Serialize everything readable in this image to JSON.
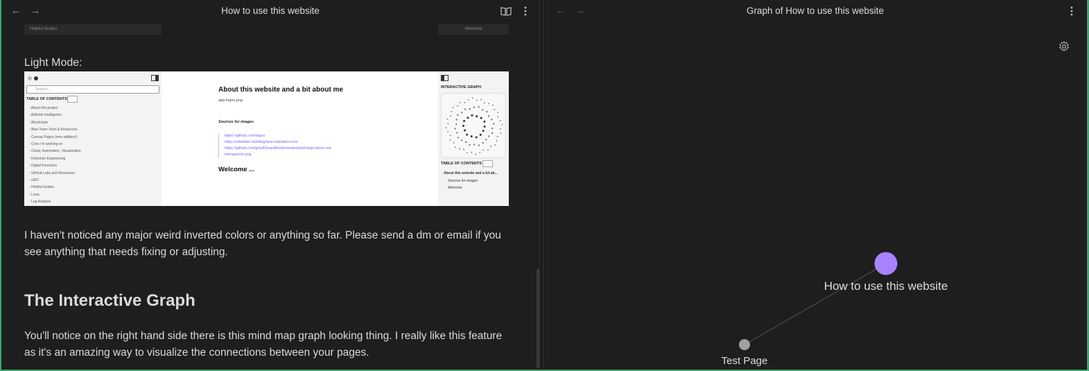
{
  "left_pane": {
    "title": "How to use this website",
    "nav_back_icon": "arrow-left-icon",
    "nav_forward_icon": "arrow-right-icon",
    "reading_view_icon": "book-open-icon",
    "more_icon": "more-vertical-icon",
    "top_strip_left": "Helpful Guides",
    "top_strip_right": "Welcome",
    "light_mode_label": "Light Mode:",
    "screenshot": {
      "search_placeholder": "Search...",
      "toc_heading": "TABLE OF CONTENTS",
      "toc_items": [
        "About this project",
        "Artificial Intelligence",
        "Blockchain",
        "Blue Team Tools & Resources",
        "Canvas Pages (new addition!)",
        "Cons I'm working on",
        "Cloud, Automation, Visualization",
        "Detection Engineering",
        "Digital Forensics",
        "GitHub Labs and Resources",
        "GRC",
        "Helpful Guides",
        "Linux",
        "Log Analysis"
      ],
      "page_title": "About this website and a bit about me",
      "image_alt": "app-logos.png",
      "sources_heading": "Sources for images",
      "links": [
        "https://github.com/logos",
        "https://obsidian.md/blog/new-obsidian-icon/",
        "https://github.com/jekyll/brand/blob/master/jekyll-logo-black-red-transparent.png"
      ],
      "welcome_heading": "Welcome ...",
      "graph_heading": "INTERACTIVE GRAPH",
      "right_toc_heading": "TABLE OF CONTENTS",
      "right_toc_items": [
        "About this website and a bit ab...",
        "Sources for images",
        "Welcome"
      ]
    },
    "paragraph_1": "I haven't noticed any major weird inverted colors or anything so far. Please send a dm or email if you see anything that needs fixing or adjusting.",
    "heading_graph": "The Interactive Graph",
    "paragraph_2": "You'll notice on the right hand side there is this mind map graph looking thing. I really like this feature as it's an amazing way to visualize the connections between your pages."
  },
  "right_pane": {
    "title": "Graph of How to use this website",
    "settings_icon": "gear-icon",
    "more_icon": "more-vertical-icon",
    "nodes": [
      {
        "label": "How to use this website",
        "color": "#a882ff",
        "role": "current"
      },
      {
        "label": "Test Page",
        "color": "#a0a0a0",
        "role": "linked"
      }
    ]
  },
  "colors": {
    "accent": "#a882ff",
    "frame": "#3ea36f",
    "background": "#1e1e1e"
  }
}
